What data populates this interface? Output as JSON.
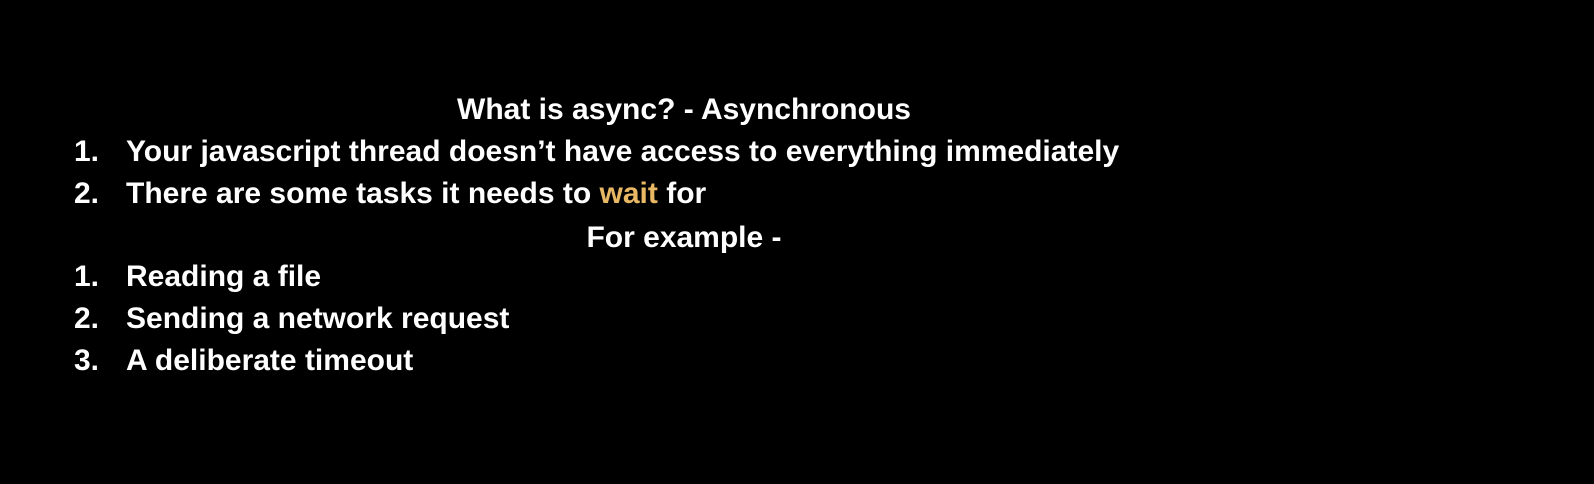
{
  "slide": {
    "title": "What is async? - Asynchronous",
    "points": [
      {
        "number": "1.",
        "text": "Your javascript thread doesn’t have access to everything immediately"
      },
      {
        "number": "2.",
        "text_before": "There are some tasks it needs to ",
        "highlight": "wait",
        "text_after": " for"
      }
    ],
    "examples_heading": "For example -",
    "examples": [
      {
        "number": "1.",
        "text": "Reading a file"
      },
      {
        "number": "2.",
        "text": "Sending a network request"
      },
      {
        "number": "3.",
        "text": "A deliberate timeout"
      }
    ]
  },
  "colors": {
    "background": "#000000",
    "text": "#ffffff",
    "highlight": "#e9b864"
  }
}
